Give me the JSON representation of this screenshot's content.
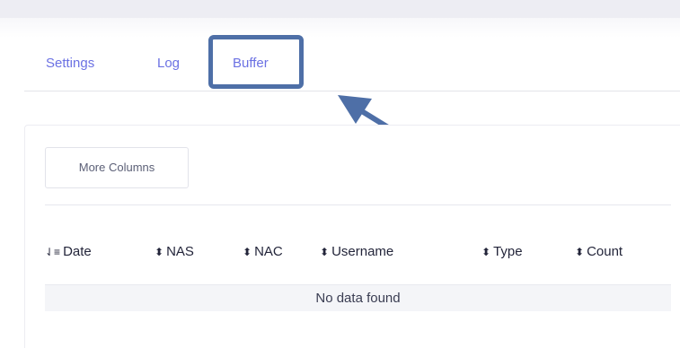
{
  "tabs": [
    {
      "label": "Settings"
    },
    {
      "label": "Log"
    },
    {
      "label": "Buffer"
    }
  ],
  "toolbar": {
    "more_columns_label": "More Columns"
  },
  "table": {
    "columns": [
      {
        "label": "Date",
        "sort_icon": "sort-desc-icon"
      },
      {
        "label": "NAS",
        "sort_icon": "sort-icon"
      },
      {
        "label": "NAC",
        "sort_icon": "sort-icon"
      },
      {
        "label": "Username",
        "sort_icon": "sort-icon"
      },
      {
        "label": "Type",
        "sort_icon": "sort-icon"
      },
      {
        "label": "Count",
        "sort_icon": "sort-icon"
      }
    ],
    "empty_message": "No data found"
  },
  "colors": {
    "accent": "#6b71e3",
    "annotation": "#4e6fa7"
  }
}
